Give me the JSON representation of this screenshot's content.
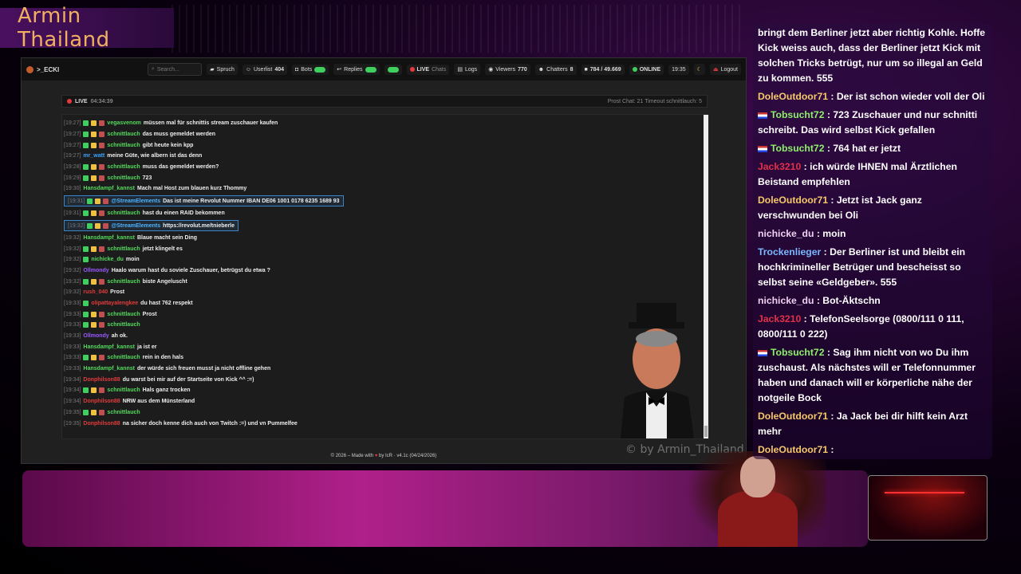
{
  "brand": {
    "title": "Armin Thailand"
  },
  "nav": {
    "channel": ">_ECKI",
    "search_placeholder": "Search...",
    "items": [
      {
        "id": "spruch",
        "label": "Spruch",
        "icon": "speech-icon"
      },
      {
        "id": "userlist",
        "label": "Userlist",
        "count": "404",
        "icon": "users-icon"
      },
      {
        "id": "bots",
        "label": "Bots",
        "icon": "robot-icon"
      },
      {
        "id": "replies",
        "label": "Replies",
        "icon": "reply-icon"
      },
      {
        "id": "live",
        "label": "LIVE",
        "sub": "Chats"
      },
      {
        "id": "logs",
        "label": "Logs",
        "icon": "file-icon"
      },
      {
        "id": "viewers",
        "label": "Viewers",
        "count": "770",
        "icon": "eye-icon"
      },
      {
        "id": "chatters",
        "label": "Chatters",
        "count": "8",
        "icon": "chat-users-icon"
      },
      {
        "id": "followers",
        "label": "784 / 49.669",
        "icon": "heart-icon"
      },
      {
        "id": "online",
        "label": "ONLINE",
        "icon": "signal-icon"
      },
      {
        "id": "clock",
        "label": "19:35"
      },
      {
        "id": "logout",
        "label": "Logout",
        "icon": "logout-icon"
      }
    ]
  },
  "status": {
    "live_label": "LIVE",
    "uptime": "04:34:39",
    "right_text": "Prost Chat: 21  Timeout schnittlauch: 5"
  },
  "messages": [
    {
      "time": "[19:27]",
      "user": "vegasvenom",
      "color": "#53d95c",
      "text": "müssen mal für schnittis stream zuschauer kaufen",
      "badges": 3
    },
    {
      "time": "[19:27]",
      "user": "schnittlauch",
      "color": "#53d95c",
      "text": "das muss gemeldet werden",
      "badges": 3
    },
    {
      "time": "[19:27]",
      "user": "schnittlauch",
      "color": "#53d95c",
      "text": "gibt heute kein kpp",
      "badges": 3
    },
    {
      "time": "[19:27]",
      "user": "mr_watt",
      "color": "#3aa3ff",
      "text": "meine Güte, wie albern ist das denn",
      "badges": 0
    },
    {
      "time": "[19:28]",
      "user": "schnittlauch",
      "color": "#53d95c",
      "text": "muss das gemeldet werden?",
      "badges": 3
    },
    {
      "time": "[19:29]",
      "user": "schnittlauch",
      "color": "#53d95c",
      "text": "723",
      "badges": 3
    },
    {
      "time": "[19:30]",
      "user": "Hansdampf_kannst",
      "color": "#53d95c",
      "text": "Mach mal Host zum blauen kurz Thommy",
      "badges": 0
    },
    {
      "time": "[19:31]",
      "user": "@StreamElements",
      "color": "#4fb3ff",
      "text": "Das ist meine Revolut Nummer IBAN DE06 1001 0178 6235 1689 93",
      "badges": 3,
      "hl": true
    },
    {
      "time": "[19:31]",
      "user": "schnittlauch",
      "color": "#53d95c",
      "text": "hast du einen RAID bekommen",
      "badges": 3
    },
    {
      "time": "[19:32]",
      "user": "@StreamElements",
      "color": "#4fb3ff",
      "text": "https://revolut.me/tnieberle",
      "badges": 3,
      "hl": true
    },
    {
      "time": "[19:32]",
      "user": "Hansdampf_kannst",
      "color": "#53d95c",
      "text": "Blaue macht sein Ding",
      "badges": 0
    },
    {
      "time": "[19:32]",
      "user": "schnittlauch",
      "color": "#53d95c",
      "text": "jetzt klingelt es",
      "badges": 3
    },
    {
      "time": "[19:32]",
      "user": "nichicke_du",
      "color": "#53d95c",
      "text": "moin",
      "badges": 1
    },
    {
      "time": "[19:32]",
      "user": "Ollmondy",
      "color": "#9b59ff",
      "text": "Haalo warum hast du soviele Zuschauer, betrügst du etwa ?",
      "badges": 0
    },
    {
      "time": "[19:32]",
      "user": "schnittlauch",
      "color": "#53d95c",
      "text": "biste Angeluscht",
      "badges": 3
    },
    {
      "time": "[19:32]",
      "user": "rush_040",
      "color": "#e23b3b",
      "text": "Prost",
      "badges": 0
    },
    {
      "time": "[19:33]",
      "user": "olipattayalengkee",
      "color": "#e23b3b",
      "text": "du hast 762 respekt",
      "badges": 1
    },
    {
      "time": "[19:33]",
      "user": "schnittlauch",
      "color": "#53d95c",
      "text": "Prost",
      "badges": 3
    },
    {
      "time": "[19:33]",
      "user": "schnittlauch",
      "color": "#53d95c",
      "text": "",
      "badges": 3
    },
    {
      "time": "[19:33]",
      "user": "Ollmondy",
      "color": "#9b59ff",
      "text": "ah ok.",
      "badges": 0
    },
    {
      "time": "[19:33]",
      "user": "Hansdampf_kannst",
      "color": "#53d95c",
      "text": "ja ist er",
      "badges": 0
    },
    {
      "time": "[19:33]",
      "user": "schnittlauch",
      "color": "#53d95c",
      "text": "rein in den hals",
      "badges": 3
    },
    {
      "time": "[19:33]",
      "user": "Hansdampf_kannst",
      "color": "#53d95c",
      "text": "der würde sich freuen musst ja nicht offline gehen",
      "badges": 0
    },
    {
      "time": "[19:34]",
      "user": "Donphilson88",
      "color": "#e23b3b",
      "text": "du warst bei mir auf der Startseite von Kick ^^ :=)",
      "badges": 0
    },
    {
      "time": "[19:34]",
      "user": "schnittlauch",
      "color": "#53d95c",
      "text": "Hals ganz trocken",
      "badges": 3
    },
    {
      "time": "[19:34]",
      "user": "Donphilson88",
      "color": "#e23b3b",
      "text": "NRW aus dem Münsterland",
      "badges": 0
    },
    {
      "time": "[19:35]",
      "user": "schnittlauch",
      "color": "#53d95c",
      "text": "",
      "badges": 3
    },
    {
      "time": "[19:35]",
      "user": "Donphilson88",
      "color": "#e23b3b",
      "text": "na sicher doch kenne dich auch von Twitch :=) und vn Pummelfee",
      "badges": 0
    }
  ],
  "footer": {
    "prefix": "© 2026 – Made with",
    "suffix": "by IcR · v4.1c (04/24/2026)"
  },
  "watermark": "© by Armin_Thailand",
  "side_chat": [
    {
      "user": "",
      "color": "#fff",
      "text": "bringt dem Berliner jetzt aber richtig Kohle. Hoffe Kick weiss auch, dass der Berliner jetzt Kick mit solchen Tricks betrügt, nur um so illegal an Geld zu kommen. 555",
      "flag": false
    },
    {
      "user": "DoleOutdoor71",
      "color": "#f6c86a",
      "text": "Der ist schon wieder voll der Oli",
      "flag": false
    },
    {
      "user": "Tobsucht72",
      "color": "#8ef06a",
      "text": "723 Zuschauer und nur schnitti schreibt. Das wird selbst Kick gefallen",
      "flag": true
    },
    {
      "user": "Tobsucht72",
      "color": "#8ef06a",
      "text": "764 hat er jetzt",
      "flag": true
    },
    {
      "user": "Jack3210",
      "color": "#e0304a",
      "text": "ich würde IHNEN mal Ärztlichen Beistand empfehlen",
      "flag": false
    },
    {
      "user": "DoleOutdoor71",
      "color": "#f6c86a",
      "text": "Jetzt ist Jack ganz verschwunden bei Oli",
      "flag": false
    },
    {
      "user": "nichicke_du",
      "color": "#f0d0f0",
      "text": "moin",
      "flag": false
    },
    {
      "user": "Trockenlieger",
      "color": "#7ab8ff",
      "text": "Der Berliner ist und bleibt ein hochkrimineller Betrüger und bescheisst so selbst seine «Geldgeber». 555",
      "flag": false
    },
    {
      "user": "nichicke_du",
      "color": "#f0d0f0",
      "text": "Bot-Äktschn",
      "flag": false
    },
    {
      "user": "Jack3210",
      "color": "#e0304a",
      "text": "TelefonSeelsorge (0800/111 0 111, 0800/111 0 222)",
      "flag": false
    },
    {
      "user": "Tobsucht72",
      "color": "#8ef06a",
      "text": "Sag ihm nicht von wo Du ihm zuschaust. Als nächstes will er Telefonnummer haben und danach will er körperliche nähe der notgeile Bock",
      "flag": true
    },
    {
      "user": "DoleOutdoor71",
      "color": "#f6c86a",
      "text": "Ja Jack bei dir hilft kein Arzt mehr",
      "flag": false
    },
    {
      "user": "DoleOutdoor71",
      "color": "#f6c86a",
      "text": "",
      "flag": false
    }
  ]
}
